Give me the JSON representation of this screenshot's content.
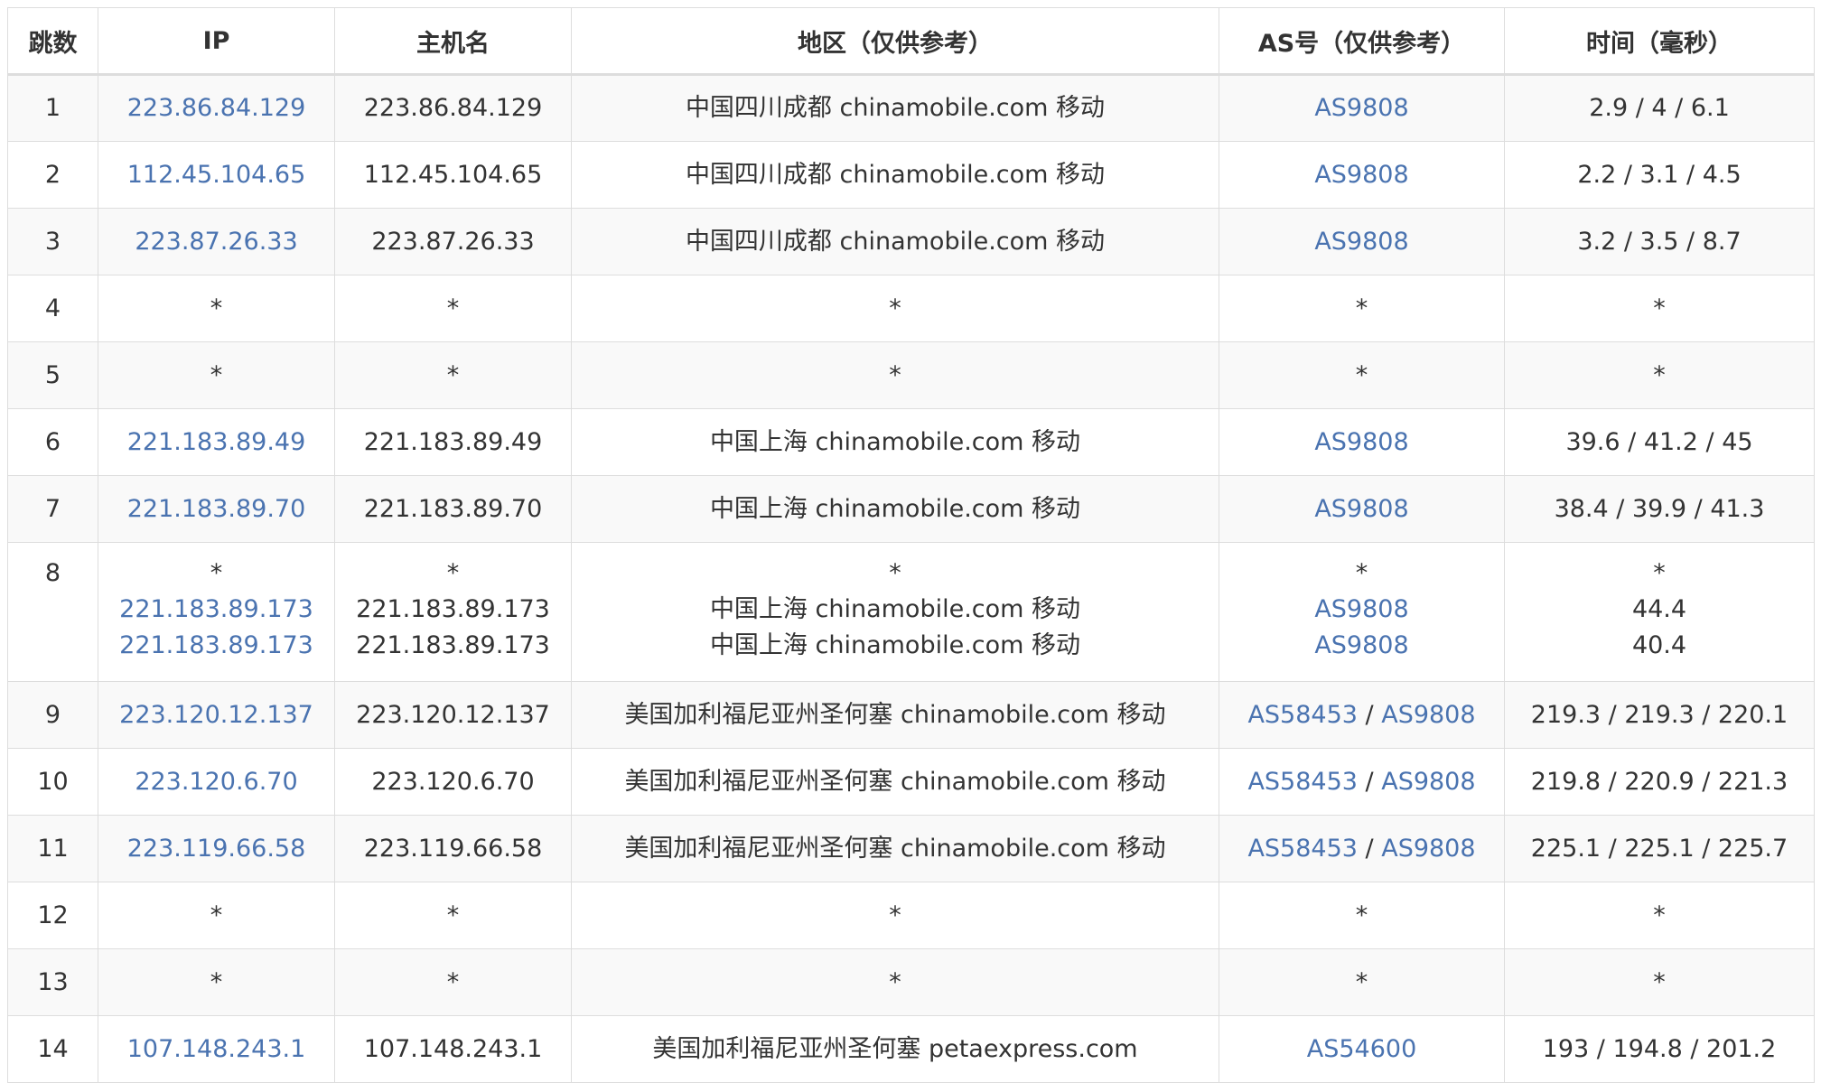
{
  "headers": {
    "hop": "跳数",
    "ip": "IP",
    "host": "主机名",
    "region": "地区（仅供参考）",
    "as": "AS号（仅供参考）",
    "time": "时间（毫秒）"
  },
  "separator": " / ",
  "rows": [
    {
      "hop": "1",
      "ip": [
        "223.86.84.129"
      ],
      "host": [
        "223.86.84.129"
      ],
      "region": [
        "中国四川成都 chinamobile.com 移动"
      ],
      "as": [
        [
          "AS9808"
        ]
      ],
      "time": [
        "2.9 / 4 / 6.1"
      ]
    },
    {
      "hop": "2",
      "ip": [
        "112.45.104.65"
      ],
      "host": [
        "112.45.104.65"
      ],
      "region": [
        "中国四川成都 chinamobile.com 移动"
      ],
      "as": [
        [
          "AS9808"
        ]
      ],
      "time": [
        "2.2 / 3.1 / 4.5"
      ]
    },
    {
      "hop": "3",
      "ip": [
        "223.87.26.33"
      ],
      "host": [
        "223.87.26.33"
      ],
      "region": [
        "中国四川成都 chinamobile.com 移动"
      ],
      "as": [
        [
          "AS9808"
        ]
      ],
      "time": [
        "3.2 / 3.5 / 8.7"
      ]
    },
    {
      "hop": "4",
      "ip": [
        "*"
      ],
      "host": [
        "*"
      ],
      "region": [
        "*"
      ],
      "as": [
        [
          "*"
        ]
      ],
      "time": [
        "*"
      ]
    },
    {
      "hop": "5",
      "ip": [
        "*"
      ],
      "host": [
        "*"
      ],
      "region": [
        "*"
      ],
      "as": [
        [
          "*"
        ]
      ],
      "time": [
        "*"
      ]
    },
    {
      "hop": "6",
      "ip": [
        "221.183.89.49"
      ],
      "host": [
        "221.183.89.49"
      ],
      "region": [
        "中国上海 chinamobile.com 移动"
      ],
      "as": [
        [
          "AS9808"
        ]
      ],
      "time": [
        "39.6 / 41.2 / 45"
      ]
    },
    {
      "hop": "7",
      "ip": [
        "221.183.89.70"
      ],
      "host": [
        "221.183.89.70"
      ],
      "region": [
        "中国上海 chinamobile.com 移动"
      ],
      "as": [
        [
          "AS9808"
        ]
      ],
      "time": [
        "38.4 / 39.9 / 41.3"
      ]
    },
    {
      "hop": "8",
      "ip": [
        "*",
        "221.183.89.173",
        "221.183.89.173"
      ],
      "host": [
        "*",
        "221.183.89.173",
        "221.183.89.173"
      ],
      "region": [
        "*",
        "中国上海 chinamobile.com 移动",
        "中国上海 chinamobile.com 移动"
      ],
      "as": [
        [
          "*"
        ],
        [
          "AS9808"
        ],
        [
          "AS9808"
        ]
      ],
      "time": [
        "*",
        "44.4",
        "40.4"
      ]
    },
    {
      "hop": "9",
      "ip": [
        "223.120.12.137"
      ],
      "host": [
        "223.120.12.137"
      ],
      "region": [
        "美国加利福尼亚州圣何塞 chinamobile.com 移动"
      ],
      "as": [
        [
          "AS58453",
          "AS9808"
        ]
      ],
      "time": [
        "219.3 / 219.3 / 220.1"
      ]
    },
    {
      "hop": "10",
      "ip": [
        "223.120.6.70"
      ],
      "host": [
        "223.120.6.70"
      ],
      "region": [
        "美国加利福尼亚州圣何塞 chinamobile.com 移动"
      ],
      "as": [
        [
          "AS58453",
          "AS9808"
        ]
      ],
      "time": [
        "219.8 / 220.9 / 221.3"
      ]
    },
    {
      "hop": "11",
      "ip": [
        "223.119.66.58"
      ],
      "host": [
        "223.119.66.58"
      ],
      "region": [
        "美国加利福尼亚州圣何塞 chinamobile.com 移动"
      ],
      "as": [
        [
          "AS58453",
          "AS9808"
        ]
      ],
      "time": [
        "225.1 / 225.1 / 225.7"
      ]
    },
    {
      "hop": "12",
      "ip": [
        "*"
      ],
      "host": [
        "*"
      ],
      "region": [
        "*"
      ],
      "as": [
        [
          "*"
        ]
      ],
      "time": [
        "*"
      ]
    },
    {
      "hop": "13",
      "ip": [
        "*"
      ],
      "host": [
        "*"
      ],
      "region": [
        "*"
      ],
      "as": [
        [
          "*"
        ]
      ],
      "time": [
        "*"
      ]
    },
    {
      "hop": "14",
      "ip": [
        "107.148.243.1"
      ],
      "host": [
        "107.148.243.1"
      ],
      "region": [
        "美国加利福尼亚州圣何塞 petaexpress.com"
      ],
      "as": [
        [
          "AS54600"
        ]
      ],
      "time": [
        "193 / 194.8 / 201.2"
      ]
    }
  ],
  "colors": {
    "link": "#4a73b0",
    "stripe": "#f9f9f9",
    "border": "#dddddd",
    "text": "#333333"
  }
}
